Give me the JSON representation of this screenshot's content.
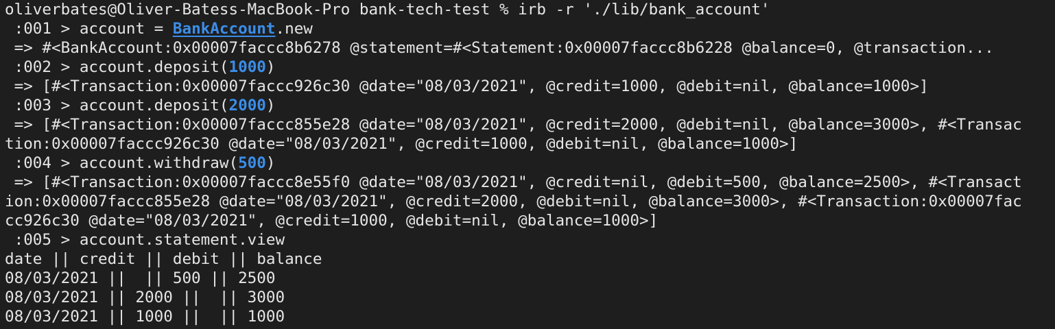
{
  "terminal": {
    "prompt": {
      "user_host": "oliverbates@Oliver-Batess-MacBook-Pro",
      "cwd": "bank-tech-test",
      "symbol": "%",
      "command": "irb -r './lib/bank_account'"
    },
    "lines": {
      "l002_prompt": " :001 > ",
      "l002_pre": "account = ",
      "l002_class": "BankAccount",
      "l002_post": ".new",
      "l003": " => #<BankAccount:0x00007faccc8b6278 @statement=#<Statement:0x00007faccc8b6228 @balance=0, @transaction...",
      "l004_prompt": " :002 > ",
      "l004_pre": "account.deposit(",
      "l004_arg": "1000",
      "l004_post": ")",
      "l005": " => [#<Transaction:0x00007faccc926c30 @date=\"08/03/2021\", @credit=1000, @debit=nil, @balance=1000>]",
      "l006_prompt": " :003 > ",
      "l006_pre": "account.deposit(",
      "l006_arg": "2000",
      "l006_post": ")",
      "l007": " => [#<Transaction:0x00007faccc855e28 @date=\"08/03/2021\", @credit=2000, @debit=nil, @balance=3000>, #<Transac",
      "l008": "tion:0x00007faccc926c30 @date=\"08/03/2021\", @credit=1000, @debit=nil, @balance=1000>]",
      "l009_prompt": " :004 > ",
      "l009_pre": "account.withdraw(",
      "l009_arg": "500",
      "l009_post": ")",
      "l010": " => [#<Transaction:0x00007faccc8e55f0 @date=\"08/03/2021\", @credit=nil, @debit=500, @balance=2500>, #<Transact",
      "l011": "ion:0x00007faccc855e28 @date=\"08/03/2021\", @credit=2000, @debit=nil, @balance=3000>, #<Transaction:0x00007fac",
      "l012": "cc926c30 @date=\"08/03/2021\", @credit=1000, @debit=nil, @balance=1000>]",
      "l013_prompt": " :005 > ",
      "l013_cmd": "account.statement.view",
      "statement_header": "date || credit || debit || balance",
      "statement_rows": [
        "08/03/2021 ||  || 500 || 2500",
        "08/03/2021 || 2000 ||  || 3000",
        "08/03/2021 || 1000 ||  || 1000"
      ]
    },
    "colors": {
      "background": "#1e1e1e",
      "text": "#e6e6e6",
      "accent": "#3b8eea"
    }
  }
}
